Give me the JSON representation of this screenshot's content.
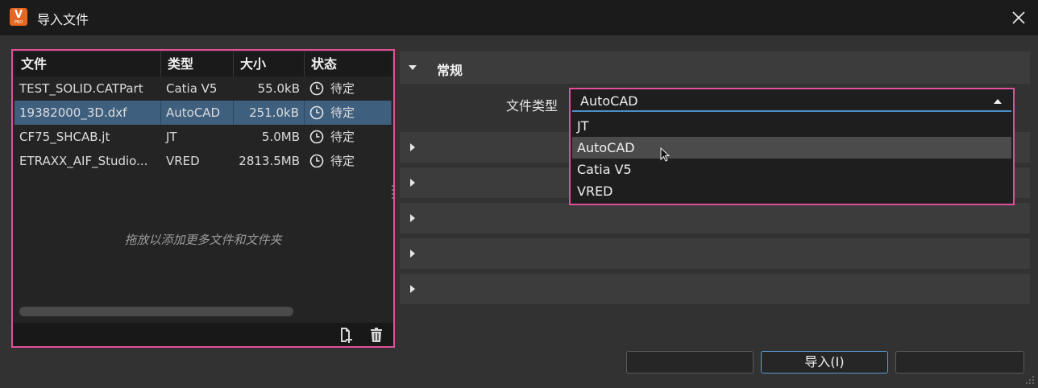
{
  "window": {
    "title": "导入文件",
    "app_icon_letter": "V",
    "app_icon_sub": "PRO",
    "close_icon": "close-icon"
  },
  "file_list": {
    "columns": [
      "文件",
      "类型",
      "大小",
      "状态"
    ],
    "rows": [
      {
        "file": "TEST_SOLID.CATPart",
        "type": "Catia V5",
        "size": "55.0kB",
        "status": "待定",
        "selected": false
      },
      {
        "file": "19382000_3D.dxf",
        "type": "AutoCAD",
        "size": "251.0kB",
        "status": "待定",
        "selected": true
      },
      {
        "file": "CF75_SHCAB.jt",
        "type": "JT",
        "size": "5.0MB",
        "status": "待定",
        "selected": false
      },
      {
        "file": "ETRAXX_AIF_Studio...",
        "type": "VRED",
        "size": "2813.5MB",
        "status": "待定",
        "selected": false
      }
    ],
    "drop_hint": "拖放以添加更多文件和文件夹",
    "footer_icons": [
      "add-file-icon",
      "trash-icon"
    ]
  },
  "settings": {
    "general_section_title": "常规",
    "file_type_label": "文件类型",
    "file_type_value": "AutoCAD",
    "file_type_options": [
      "JT",
      "AutoCAD",
      "Catia V5",
      "VRED"
    ],
    "hovered_option": "AutoCAD",
    "collapsed_sections": 5
  },
  "buttons": {
    "left_label": "",
    "import_label": "导入(I)",
    "right_label": ""
  },
  "colors": {
    "highlight_border": "#e0509a",
    "selection": "#3f5f7f",
    "focus_accent": "#4a8fc7",
    "app_icon": "#e8661d"
  }
}
